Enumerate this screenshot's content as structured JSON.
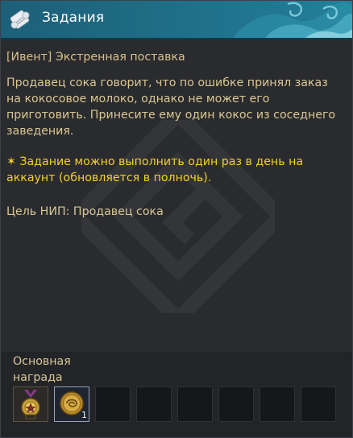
{
  "window": {
    "title": "Задания",
    "header_color": "#1f6d86",
    "icon": "scroll-icon"
  },
  "quest": {
    "subtitle": "[Ивент] Экстренная поставка",
    "description": "Продавец сока говорит, что по ошибке принял заказ\nна кокосовое молоко, однако не может его\nприготовить. Принесите ему один кокос из соседнего\nзаведения.",
    "note": "✶ Задание можно выполнить один раз в день на\nаккаунт (обновляется в полночь).",
    "target": "Цель НИП: Продавец сока"
  },
  "rewards": {
    "label": "Основная\nнаграда",
    "items": [
      {
        "icon": "medal-icon",
        "count": ""
      },
      {
        "icon": "gold-coin-icon",
        "count": "1"
      },
      {
        "icon": "empty-slot",
        "count": ""
      },
      {
        "icon": "empty-slot",
        "count": ""
      },
      {
        "icon": "empty-slot",
        "count": ""
      },
      {
        "icon": "empty-slot",
        "count": ""
      },
      {
        "icon": "empty-slot",
        "count": ""
      },
      {
        "icon": "empty-slot",
        "count": ""
      }
    ]
  },
  "colors": {
    "text": "#d9c792",
    "highlight": "#f3d02a",
    "background": "#2a2b2f"
  }
}
